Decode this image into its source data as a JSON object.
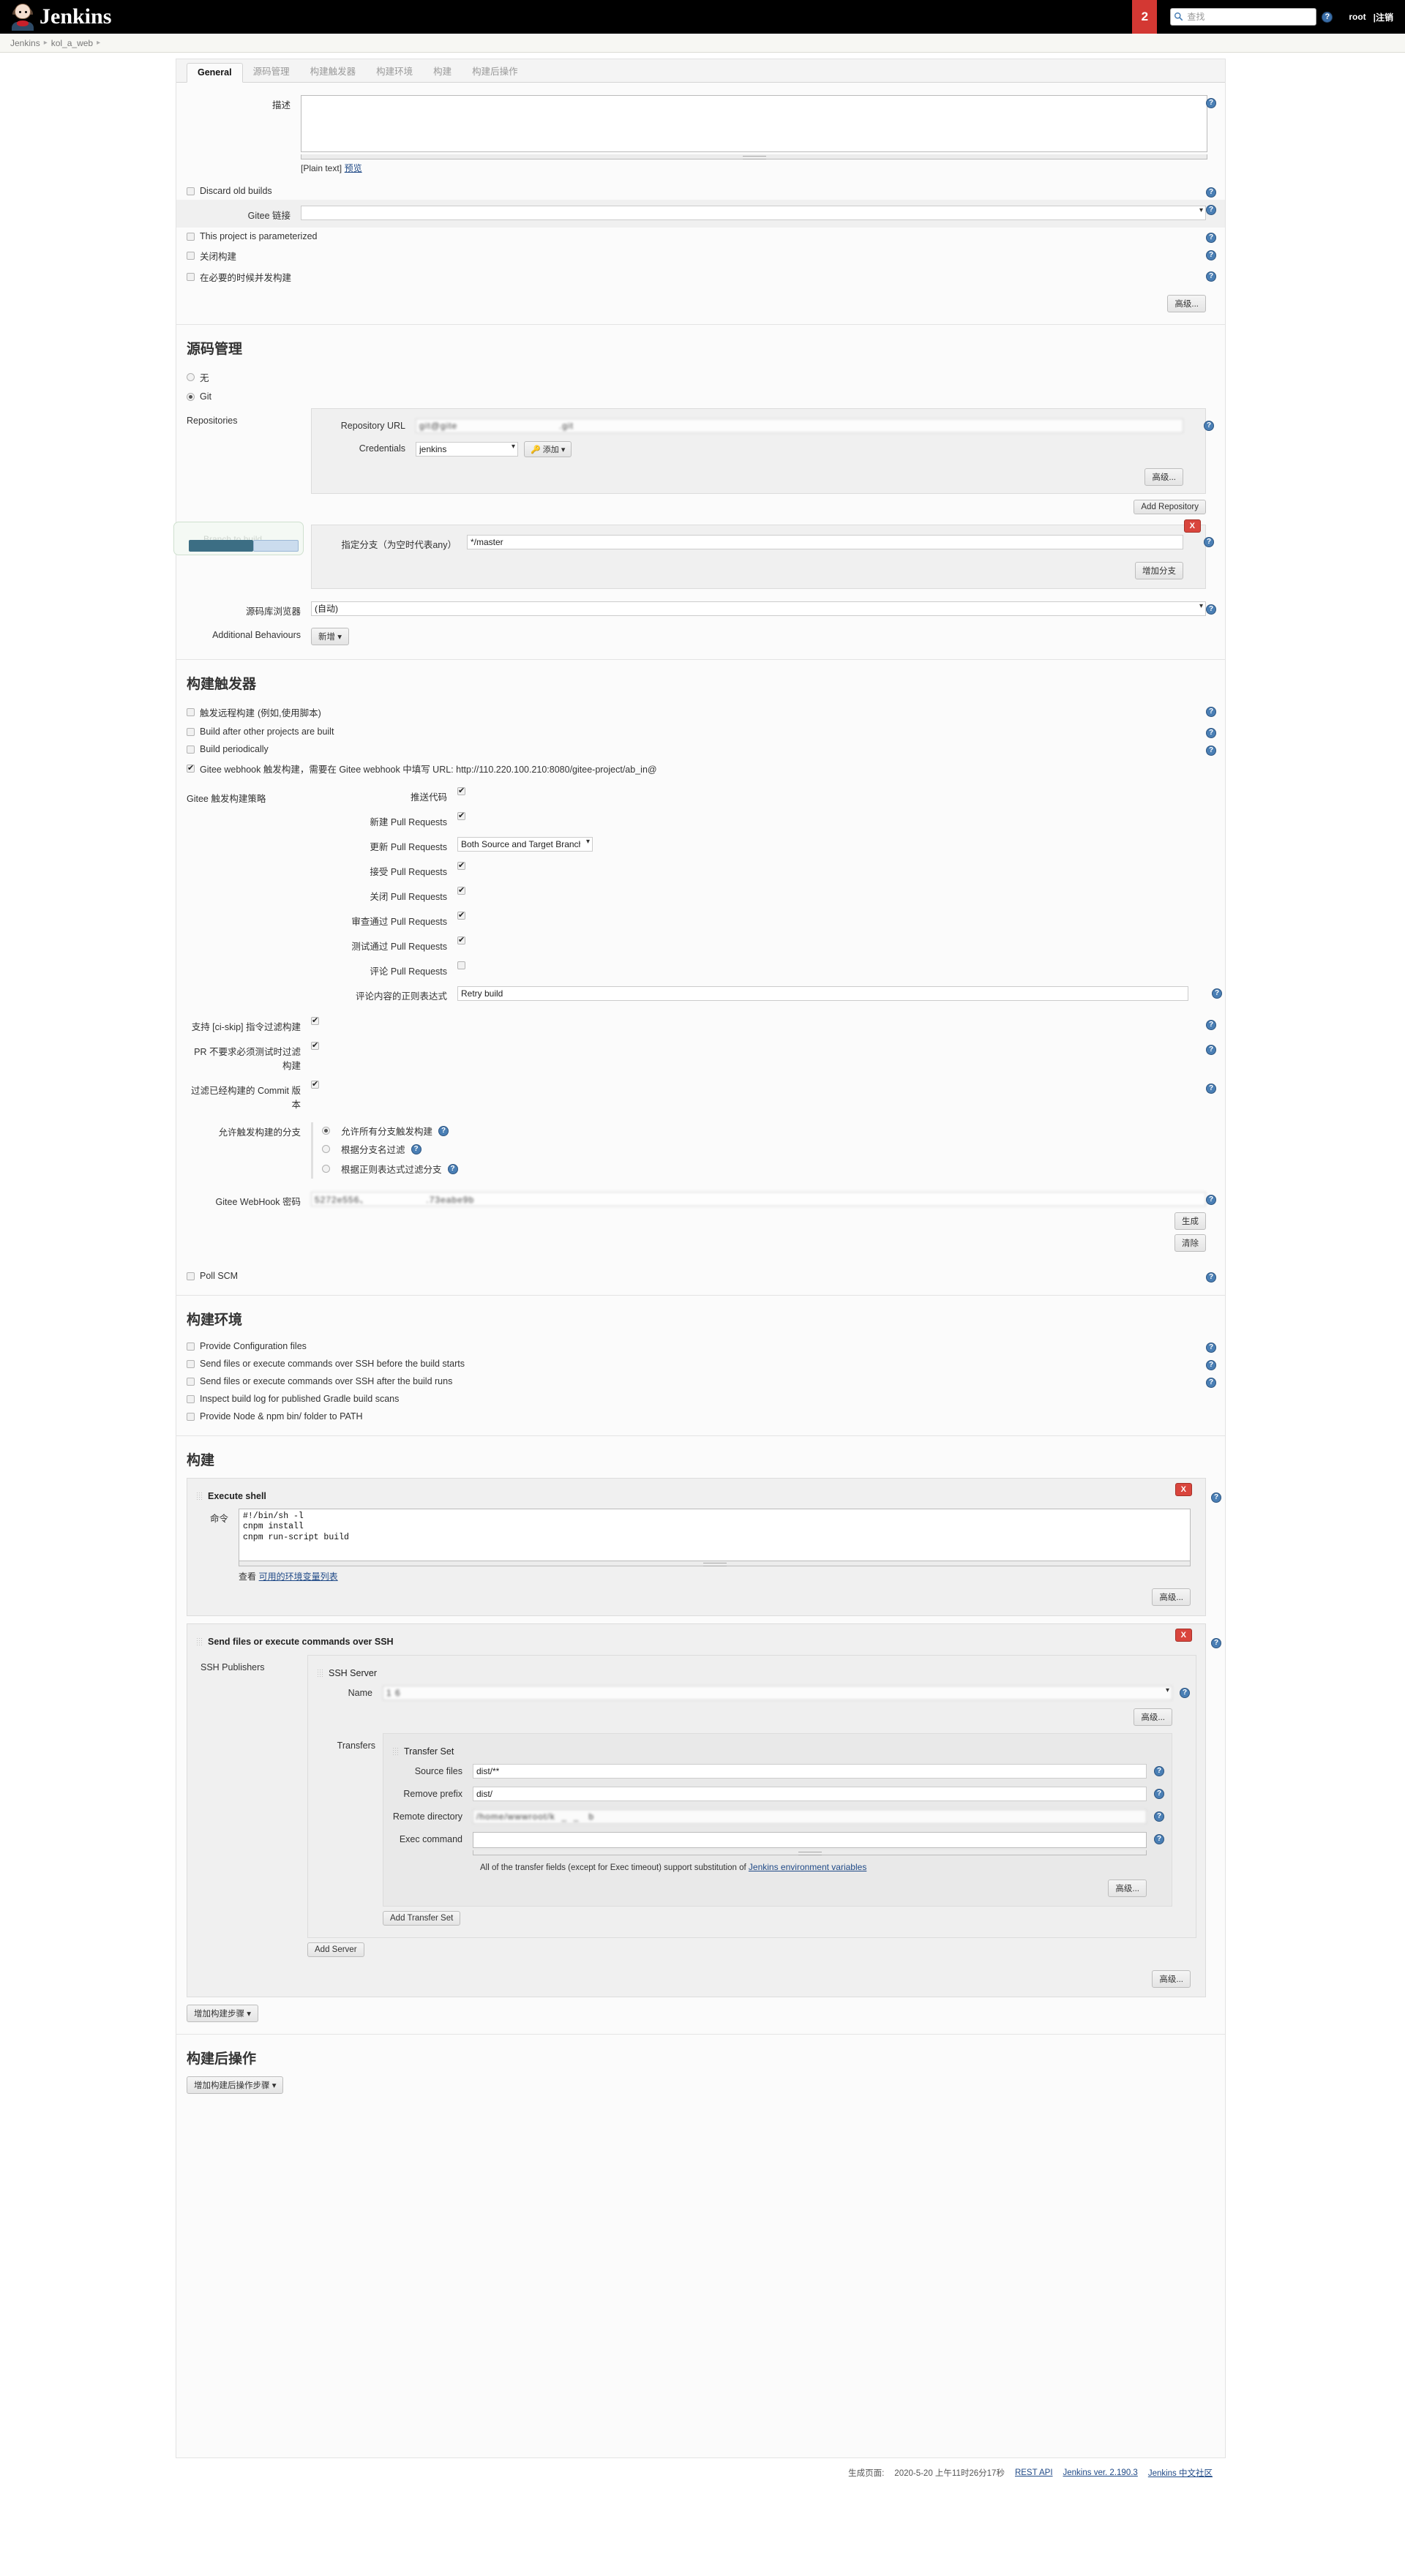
{
  "header": {
    "brand": "Jenkins",
    "queue_count": "2",
    "search_placeholder": "查找",
    "search_value": "",
    "help_icon": "help-circle-icon",
    "user": "root",
    "logout": "|注销"
  },
  "breadcrumb": {
    "items": [
      "Jenkins",
      "kol_a_web"
    ]
  },
  "tabs": [
    {
      "label": "General",
      "active": true
    },
    {
      "label": "源码管理",
      "active": false
    },
    {
      "label": "构建触发器",
      "active": false
    },
    {
      "label": "构建环境",
      "active": false
    },
    {
      "label": "构建",
      "active": false
    },
    {
      "label": "构建后操作",
      "active": false
    }
  ],
  "general": {
    "description_label": "描述",
    "description_value": "",
    "plain_text_note": "[Plain text]",
    "preview_link": "预览",
    "discard_old_builds": {
      "label": "Discard old builds",
      "checked": false
    },
    "gitee_link_label": "Gitee 链接",
    "gitee_link_value": "",
    "parameterized": {
      "label": "This project is parameterized",
      "checked": false
    },
    "disable_build": {
      "label": "关闭构建",
      "checked": false
    },
    "concurrent_build": {
      "label": "在必要的时候并发构建",
      "checked": false
    },
    "advanced_button": "高级..."
  },
  "scm": {
    "title": "源码管理",
    "option_none": "无",
    "option_git": "Git",
    "selected": "Git",
    "repositories_label": "Repositories",
    "repository_url_label": "Repository URL",
    "repository_url_value": "git@gite                                .git",
    "credentials_label": "Credentials",
    "credentials_value": "jenkins",
    "add_credentials_button": "添加",
    "advanced_button": "高级...",
    "add_repository_button": "Add Repository",
    "branches_label": "指定分支（为空时代表any）",
    "branches_value": "*/master",
    "add_branch_button": "增加分支",
    "delete_branch_button": "X",
    "browser_label": "源码库浏览器",
    "browser_value": "(自动)",
    "additional_behaviours_label": "Additional Behaviours",
    "add_behaviour_button": "新增"
  },
  "triggers": {
    "title": "构建触发器",
    "remote_build": {
      "label": "触发远程构建",
      "suffix": "(例如,使用脚本)",
      "checked": false
    },
    "build_after_other": {
      "label": "Build after other projects are built",
      "checked": false
    },
    "build_periodically": {
      "label": "Build periodically",
      "checked": false
    },
    "gitee_webhook": {
      "label": "Gitee webhook 触发构建，需要在 Gitee webhook 中填写 URL: http://110.220.100.210:8080/gitee-project/ab_in@",
      "checked": true
    },
    "strategy_label": "Gitee 触发构建策略",
    "strategy_items": [
      {
        "label": "推送代码",
        "type": "checkbox",
        "checked": true
      },
      {
        "label": "新建 Pull Requests",
        "type": "checkbox",
        "checked": true
      },
      {
        "label": "更新 Pull Requests",
        "type": "select",
        "value": "Both Source and Target Branch updated"
      },
      {
        "label": "接受 Pull Requests",
        "type": "checkbox",
        "checked": true
      },
      {
        "label": "关闭 Pull Requests",
        "type": "checkbox",
        "checked": true
      },
      {
        "label": "审查通过 Pull Requests",
        "type": "checkbox",
        "checked": true
      },
      {
        "label": "测试通过 Pull Requests",
        "type": "checkbox",
        "checked": true
      },
      {
        "label": "评论 Pull Requests",
        "type": "checkbox",
        "checked": false
      },
      {
        "label": "评论内容的正则表达式",
        "type": "text",
        "value": "Retry build"
      }
    ],
    "ci_skip": {
      "label": "支持 [ci-skip] 指令过滤构建",
      "checked": true
    },
    "pr_no_test": {
      "label": "PR 不要求必须测试时过滤构建",
      "checked": true
    },
    "filter_built_commit": {
      "label": "过滤已经构建的 Commit 版本",
      "checked": true
    },
    "allow_branches_label": "允许触发构建的分支",
    "allow_branch_options": [
      {
        "label": "允许所有分支触发构建",
        "selected": true
      },
      {
        "label": "根据分支名过滤",
        "selected": false
      },
      {
        "label": "根据正则表达式过滤分支",
        "selected": false
      }
    ],
    "webhook_password_label": "Gitee WebHook 密码",
    "webhook_password_value": "5272e556、                  .73eabe9b",
    "generate_button": "生成",
    "clear_button": "清除",
    "poll_scm": {
      "label": "Poll SCM",
      "checked": false
    }
  },
  "build_env": {
    "title": "构建环境",
    "items": [
      {
        "label": "Provide Configuration files",
        "checked": false
      },
      {
        "label": "Send files or execute commands over SSH before the build starts",
        "checked": false
      },
      {
        "label": "Send files or execute commands over SSH after the build runs",
        "checked": false
      },
      {
        "label": "Inspect build log for published Gradle build scans",
        "checked": false
      },
      {
        "label": "Provide Node & npm bin/ folder to PATH",
        "checked": false
      }
    ]
  },
  "build": {
    "title": "构建",
    "execute_shell": {
      "title": "Execute shell",
      "command_label": "命令",
      "command_lines": [
        "#!/bin/sh -l",
        "cnpm install",
        "cnpm run-script build"
      ],
      "env_note_prefix": "查看",
      "env_note_link": "可用的环境变量列表",
      "advanced_button": "高级...",
      "delete_button": "X"
    },
    "ssh_publisher": {
      "title": "Send files or execute commands over SSH",
      "delete_button": "X",
      "publishers_label": "SSH Publishers",
      "server_title": "SSH Server",
      "name_label": "Name",
      "name_value": "1                 6",
      "server_advanced_button": "高级...",
      "transfers_label": "Transfers",
      "transfer_set_title": "Transfer Set",
      "source_files_label": "Source files",
      "source_files_value": "dist/**",
      "remove_prefix_label": "Remove prefix",
      "remove_prefix_value": "dist/",
      "remote_directory_label": "Remote directory",
      "remote_directory_value": "/home/wwwroot/k  _  _   b",
      "exec_command_label": "Exec command",
      "exec_command_value": "",
      "note_prefix": "All of the transfer fields (except for Exec timeout) support substitution of ",
      "note_link": "Jenkins environment variables",
      "transfer_advanced_button": "高级...",
      "add_transfer_set_button": "Add Transfer Set",
      "add_server_button": "Add Server",
      "bottom_advanced_button": "高级..."
    },
    "add_build_step_button": "增加构建步骤"
  },
  "post_build": {
    "title": "构建后操作",
    "add_post_build_step_button": "增加构建后操作步骤"
  },
  "footer": {
    "generated_label": "生成页面:",
    "generated_time": "2020-5-20 上午11时26分17秒",
    "rest_api": "REST API",
    "version": "Jenkins ver. 2.190.3",
    "community": "Jenkins 中文社区"
  }
}
